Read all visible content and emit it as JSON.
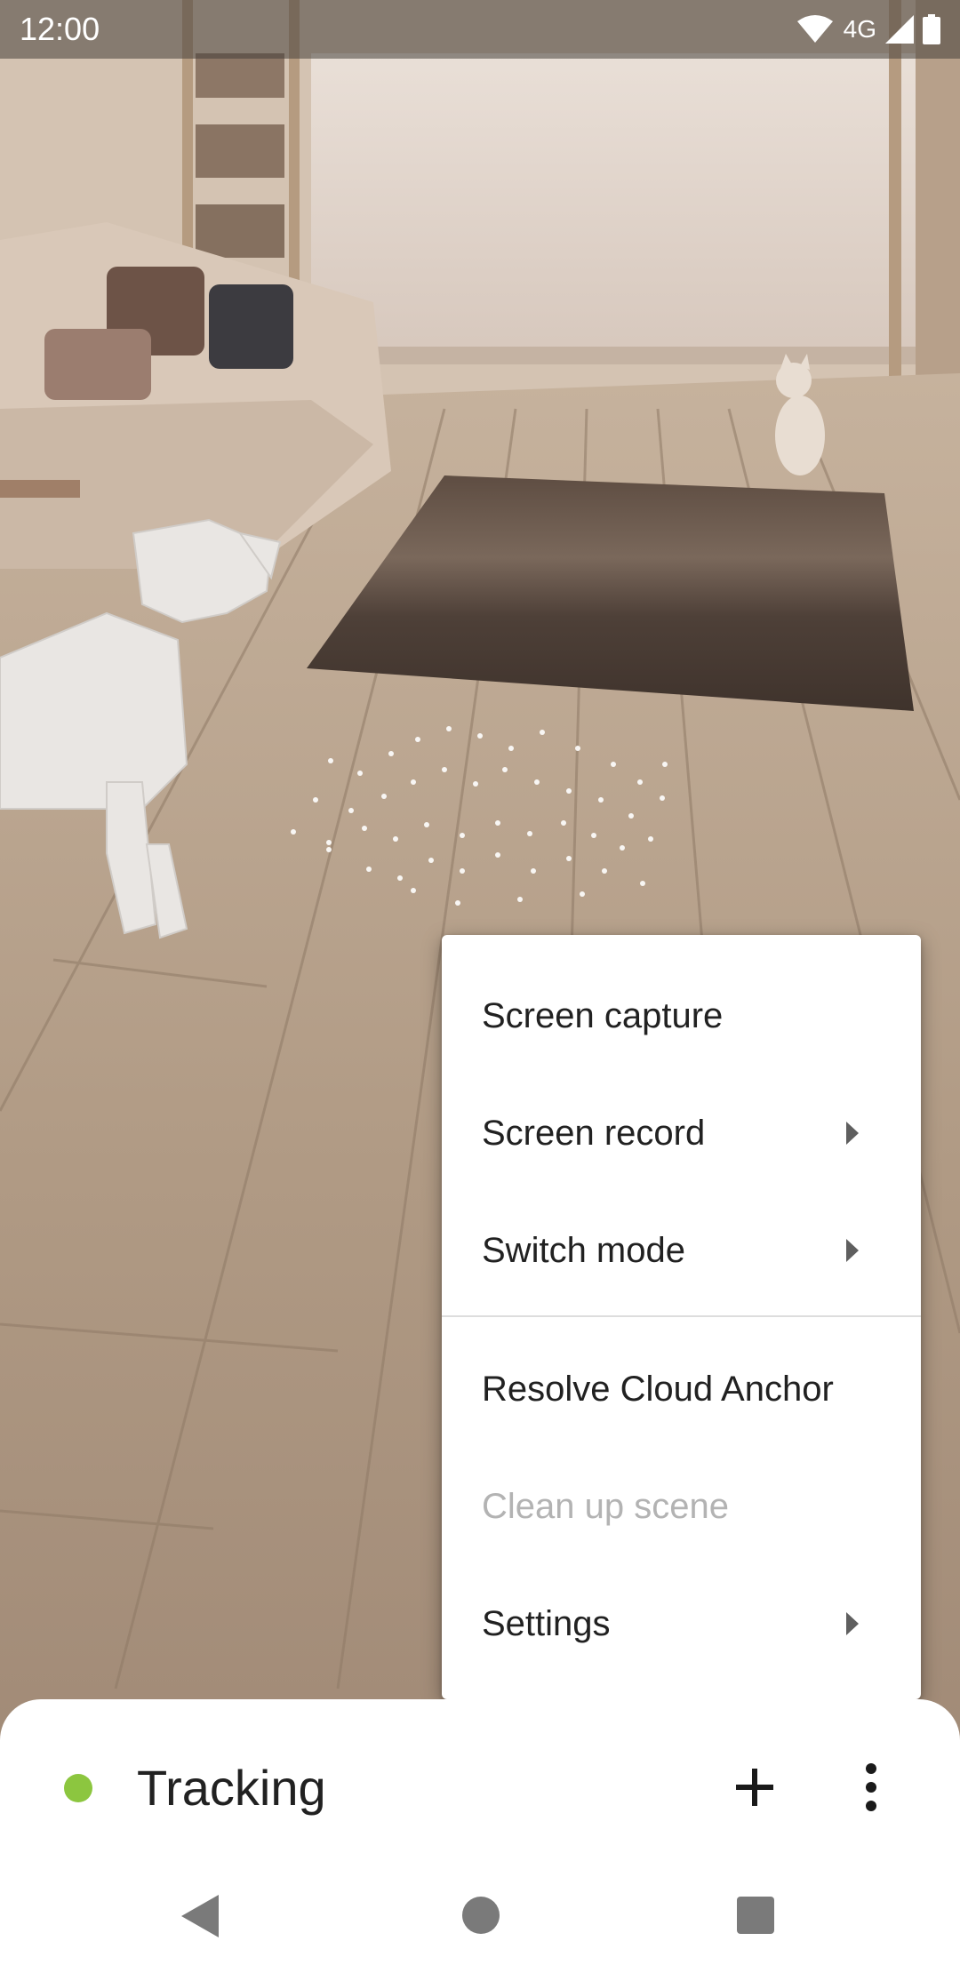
{
  "status_bar": {
    "time": "12:00",
    "network": "4G",
    "icons": [
      "wifi-icon",
      "cell-signal-icon",
      "battery-icon"
    ]
  },
  "menu": {
    "items": [
      {
        "label": "Screen capture",
        "has_submenu": false,
        "enabled": true
      },
      {
        "label": "Screen record",
        "has_submenu": true,
        "enabled": true
      },
      {
        "label": "Switch mode",
        "has_submenu": true,
        "enabled": true
      },
      {
        "label": "Resolve Cloud Anchor",
        "has_submenu": false,
        "enabled": true
      },
      {
        "label": "Clean up scene",
        "has_submenu": false,
        "enabled": false
      },
      {
        "label": "Settings",
        "has_submenu": true,
        "enabled": true
      }
    ]
  },
  "bottom_panel": {
    "status_label": "Tracking",
    "status_color": "#8cc63f",
    "actions": [
      "plus-icon",
      "more-vert-icon"
    ]
  },
  "nav_bar": {
    "buttons": [
      "back-icon",
      "home-icon",
      "recents-icon"
    ]
  },
  "colors": {
    "menu_text": "#212121",
    "menu_disabled_text": "#b3b3b3",
    "tracking_dot": "#8cc63f"
  }
}
